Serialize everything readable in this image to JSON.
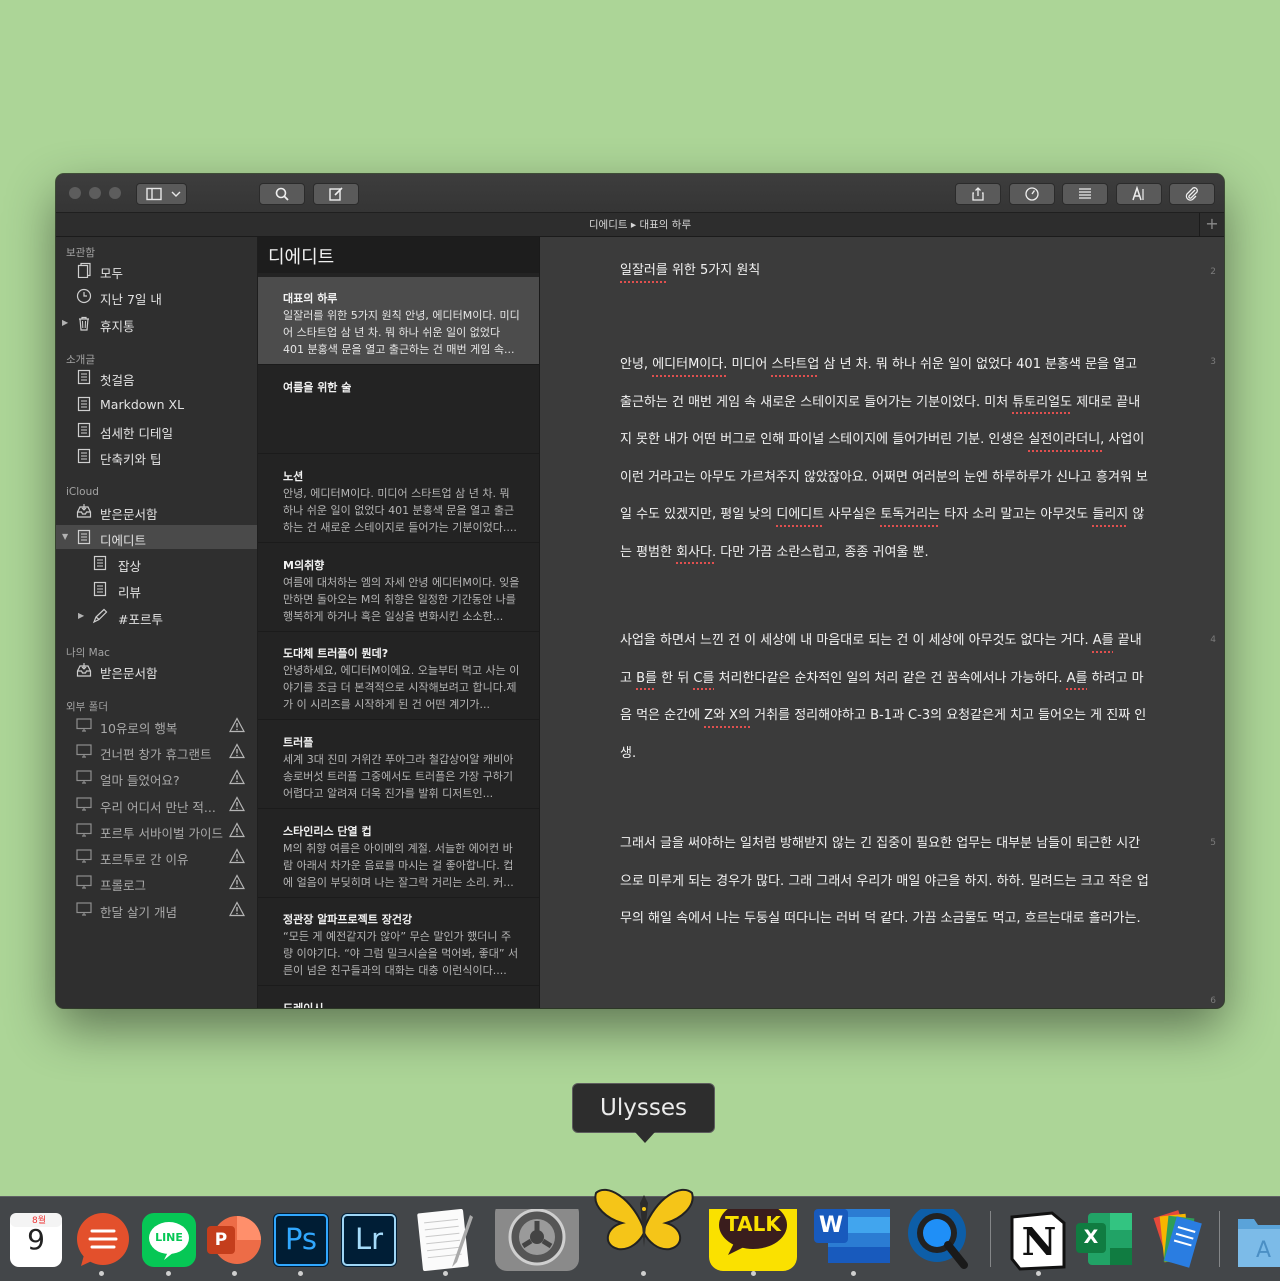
{
  "app_name": "Ulysses",
  "path": "디에디트 ▸ 대표의 하루",
  "plus_label": "+",
  "sidebar": {
    "sections": [
      {
        "title": "보관함",
        "items": [
          {
            "label": "모두",
            "icon": "sheets-icon"
          },
          {
            "label": "지난 7일 내",
            "icon": "clock-icon"
          },
          {
            "label": "휴지통",
            "icon": "trash-icon"
          }
        ]
      },
      {
        "title": "소개글",
        "items": [
          {
            "label": "첫걸음",
            "icon": "document-icon"
          },
          {
            "label": "Markdown XL",
            "icon": "document-icon"
          },
          {
            "label": "섬세한 디테일",
            "icon": "document-icon"
          },
          {
            "label": "단축키와 팁",
            "icon": "document-icon"
          }
        ]
      },
      {
        "title": "iCloud",
        "items": [
          {
            "label": "받은문서함",
            "icon": "inbox-icon"
          },
          {
            "label": "디에디트",
            "icon": "document-icon",
            "selected": true
          },
          {
            "label": "잡상",
            "icon": "document-icon"
          },
          {
            "label": "리뷰",
            "icon": "document-icon"
          },
          {
            "label": "#포르투",
            "icon": "pen-icon"
          }
        ]
      },
      {
        "title": "나의 Mac",
        "items": [
          {
            "label": "받은문서함",
            "icon": "inbox-icon"
          }
        ]
      },
      {
        "title": "외부 폴더",
        "items": [
          {
            "label": "10유로의 행복",
            "icon": "monitor-icon"
          },
          {
            "label": "건너편 창가 휴그랜트",
            "icon": "monitor-icon"
          },
          {
            "label": "얼마 들었어요?",
            "icon": "monitor-icon"
          },
          {
            "label": "우리 어디서 만난 적...",
            "icon": "monitor-icon"
          },
          {
            "label": "포르투 서바이벌 가이드",
            "icon": "monitor-icon"
          },
          {
            "label": "포르투로 간 이유",
            "icon": "monitor-icon"
          },
          {
            "label": "프롤로그",
            "icon": "monitor-icon"
          },
          {
            "label": "한달 살기 개념",
            "icon": "monitor-icon"
          }
        ]
      }
    ]
  },
  "sheet_list": {
    "title": "디에디트",
    "sheets": [
      {
        "title": "대표의 하루",
        "body": "일잘러를 위한 5가지 원칙 안녕, 에디터M이다. 미디어 스타트업 삼 년 차. 뭐 하나 쉬운 일이 없었다 401 분홍색 문을 열고 출근하는 건 매번 게임 속..."
      },
      {
        "title": "여름을 위한 술",
        "body": ""
      },
      {
        "title": "노션",
        "body": "안녕, 에디터M이다. 미디어 스타트업 삼 년 차. 뭐 하나 쉬운 일이 없었다 401 분홍색 문을 열고 출근하는 건 새로운 스테이지로 들어가는 기분이었다...."
      },
      {
        "title": "M의취향",
        "body": "여름에 대처하는 엠의 자세 안녕 에디터M이다. 잊을 만하면 돌아오는 M의 취향은 일정한 기간동안 나를 행복하게 하거나 혹은 일상을 변화시킨 소소한..."
      },
      {
        "title": "도대체 트러플이 뭔데?",
        "body": "안녕하세요, 에디터M이에요. 오늘부터 먹고 사는 이야기를 조금 더 본격적으로 시작해보려고 합니다.제가 이 시리즈를 시작하게 된 건 어떤 계기가..."
      },
      {
        "title": "트러플",
        "body": "세계 3대 진미 거위간 푸아그라 철갑상어알 캐비아 송로버섯 트러플 그중에서도 트러플은 가장 구하기 어렵다고 알려져 더욱 진가를 발휘 디저트인..."
      },
      {
        "title": "스타인리스 단열 컵",
        "body": "M의 취향 여름은 아이메의 계절. 서늘한 에어컨 바람 아래서 차가운 음료를 마시는 걸 좋아합니다. 컵에 얼음이 부딪히며 나는 잘그락 거리는 소리. 커..."
      },
      {
        "title": "정관장 알파프로젝트 장건강",
        "body": "“모든 게 예전같지가 않아” 무슨 말인가 했더니 주량 이야기다. “야 그럼 밀크시슬을 먹어봐, 좋대” 서른이 넘은 친구들과의 대화는 대충 이런식이다...."
      },
      {
        "title": "도레이시",
        "body": ""
      }
    ]
  },
  "editor": {
    "paragraphs": [
      {
        "line": "2",
        "text": "일잘러를 위한 5가지 원칙"
      },
      {
        "line": "3",
        "text": "안녕, 에디터M이다. 미디어 스타트업 삼 년 차. 뭐 하나 쉬운 일이 없었다 401 분홍색 문을 열고 출근하는 건 매번 게임 속 새로운 스테이지로 들어가는 기분이었다. 미처 튜토리얼도 제대로 끝내지 못한 내가 어떤 버그로 인해 파이널 스테이지에 들어가버린 기분. 인생은 실전이라더니, 사업이 이런 거라고는 아무도 가르쳐주지 않았잖아요. 어쩌면 여러분의 눈엔 하루하루가 신나고 흥겨워 보일 수도 있겠지만, 평일 낮의 디에디트 사무실은 토독거리는 타자 소리 말고는 아무것도 들리지 않는 평범한 회사다. 다만 가끔 소란스럽고, 종종 귀여울 뿐."
      },
      {
        "line": "4",
        "text": "사업을 하면서 느낀 건 이 세상에 내 마음대로 되는 건 이 세상에 아무것도 없다는 거다. A를 끝내고 B를 한 뒤 C를 처리한다같은 순차적인 일의 처리 같은 건 꿈속에서나 가능하다. A를 하려고 마음 먹은 순간에 Z와 X의 거취를 정리해야하고 B-1과 C-3의 요청같은게 치고 들어오는 게 진짜 인생."
      },
      {
        "line": "5",
        "text": "그래서 글을 써야하는 일처럼 방해받지 않는 긴 집중이 필요한 업무는 대부분 남들이 퇴근한 시간으로 미루게 되는 경우가 많다. 그래 그래서 우리가 매일 야근을 하지. 하하. 밀려드는 크고 작은 업무의 해일 속에서 나는 두둥실 떠다니는 러버 덕 같다. 가끔 소금물도 먹고, 흐르는대로 흘러가는."
      },
      {
        "line": "6",
        "text": ""
      }
    ]
  },
  "dock": {
    "tooltip": "Ulysses",
    "apps": [
      {
        "name": "Calendar",
        "icon": "calendar-icon",
        "month": "8월",
        "day": "9"
      },
      {
        "name": "Speeko",
        "icon": "speech-bubble-icon"
      },
      {
        "name": "LINE",
        "icon": "line-icon",
        "text": "LINE"
      },
      {
        "name": "PowerPoint",
        "icon": "powerpoint-icon",
        "text": "P"
      },
      {
        "name": "Photoshop",
        "icon": "photoshop-icon",
        "text": "Ps"
      },
      {
        "name": "Lightroom",
        "icon": "lightroom-icon",
        "text": "Lr"
      },
      {
        "name": "TextEdit",
        "icon": "notepad-icon"
      },
      {
        "name": "System Preferences",
        "icon": "gear-icon"
      },
      {
        "name": "Ulysses",
        "icon": "butterfly-icon"
      },
      {
        "name": "KakaoTalk",
        "icon": "kakaotalk-icon",
        "text": "TALK"
      },
      {
        "name": "Word",
        "icon": "word-icon",
        "text": "W"
      },
      {
        "name": "QuickTime Player",
        "icon": "quicktime-icon"
      },
      {
        "name": "Notion",
        "icon": "notion-icon",
        "text": "N"
      },
      {
        "name": "Excel",
        "icon": "excel-icon",
        "text": "X"
      },
      {
        "name": "Keynote",
        "icon": "stacked-docs-icon"
      },
      {
        "name": "Applications",
        "icon": "folder-icon"
      }
    ]
  }
}
